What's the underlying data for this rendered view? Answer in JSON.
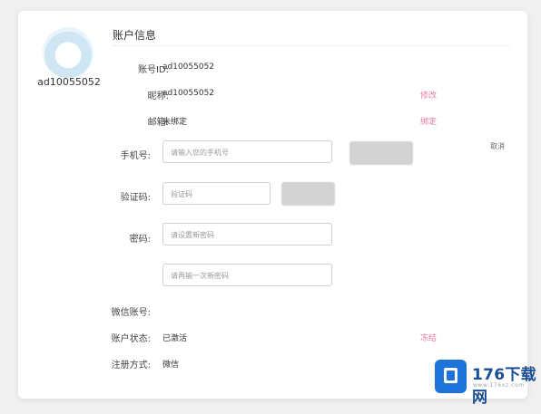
{
  "profile": {
    "username": "ad10055052"
  },
  "header": {
    "title": "账户信息"
  },
  "fields": {
    "account_id": {
      "label": "账号ID:",
      "value": "ad10055052"
    },
    "nickname": {
      "label": "昵称:",
      "value": "ad10055052",
      "action": "修改"
    },
    "email": {
      "label": "邮箱:",
      "value": "未绑定",
      "action": "绑定"
    },
    "phone": {
      "label": "手机号:",
      "placeholder": "请输入您的手机号",
      "cancel": "取消"
    },
    "code": {
      "label": "验证码:",
      "placeholder": "验证码"
    },
    "password": {
      "label": "密码:",
      "placeholder": "请设置新密码",
      "confirm_placeholder": "请再输一次新密码"
    },
    "wechat": {
      "label": "微信账号:"
    },
    "status": {
      "label": "账户状态:",
      "value": "已激活",
      "action": "冻结"
    },
    "register": {
      "label": "注册方式:",
      "value": "微信"
    }
  },
  "watermark": {
    "brand": "176下载网",
    "url": "www.176xz.com"
  },
  "colors": {
    "accent_pink": "#e87b9c",
    "watermark_blue": "#1e73d8"
  }
}
